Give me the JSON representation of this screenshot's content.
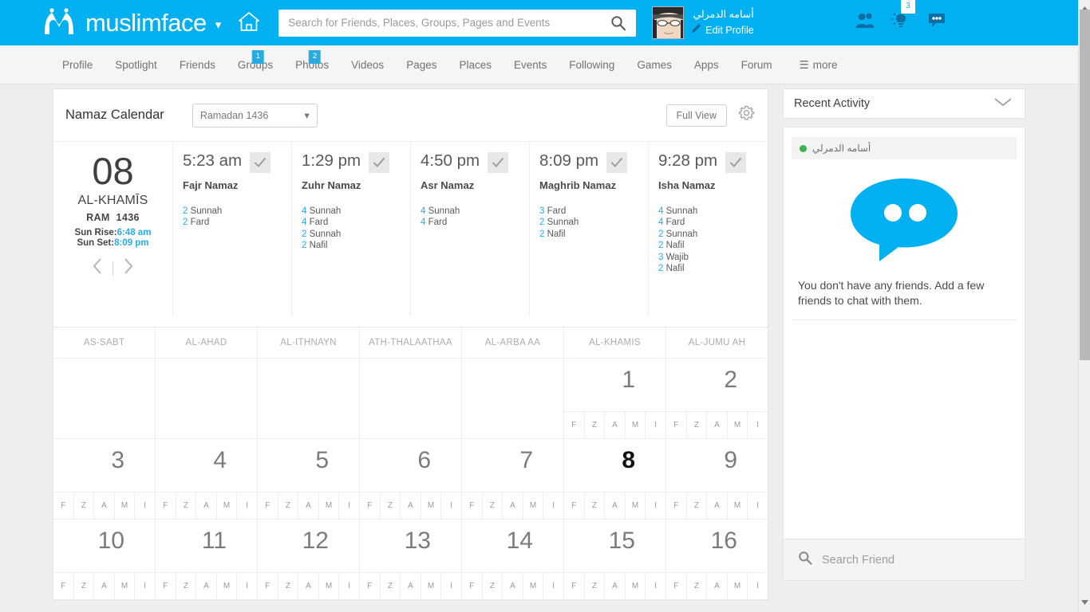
{
  "topbar": {
    "brand": "muslimface",
    "brand_caret": "chevron-down",
    "search_placeholder": "Search for Friends, Places, Groups, Pages and Events",
    "search_value": "",
    "user_name": "أسامه الدمرلي",
    "edit_profile": "Edit Profile",
    "notification_badge": "3",
    "accent": "#00b0f0"
  },
  "nav": {
    "items": [
      {
        "label": "Profile",
        "badge": ""
      },
      {
        "label": "Spotlight",
        "badge": ""
      },
      {
        "label": "Friends",
        "badge": ""
      },
      {
        "label": "Groups",
        "badge": "1"
      },
      {
        "label": "Photos",
        "badge": "2"
      },
      {
        "label": "Videos",
        "badge": ""
      },
      {
        "label": "Pages",
        "badge": ""
      },
      {
        "label": "Places",
        "badge": ""
      },
      {
        "label": "Events",
        "badge": ""
      },
      {
        "label": "Following",
        "badge": ""
      },
      {
        "label": "Games",
        "badge": ""
      },
      {
        "label": "Apps",
        "badge": ""
      },
      {
        "label": "Forum",
        "badge": ""
      }
    ],
    "more_label": "more",
    "badge_color": "#29abe2"
  },
  "calendar": {
    "title": "Namaz Calendar",
    "month_select": "Ramadan 1436",
    "full_view_label": "Full View",
    "settings_icon": "gear-icon",
    "day": {
      "number": "08",
      "name": "AL-KHAMĪS",
      "month_abbr": "RAM",
      "year": "1436",
      "sun_rise_label": "Sun Rise:",
      "sun_rise_value": "6:48 am",
      "sun_set_label": "Sun Set:",
      "sun_set_value": "8:09 pm"
    },
    "prayers": [
      {
        "time": "5:23 am",
        "name": "Fajr Namaz",
        "checked": true,
        "units": [
          {
            "count": "2",
            "type": "Sunnah"
          },
          {
            "count": "2",
            "type": "Fard"
          }
        ]
      },
      {
        "time": "1:29 pm",
        "name": "Zuhr Namaz",
        "checked": true,
        "units": [
          {
            "count": "4",
            "type": "Sunnah"
          },
          {
            "count": "4",
            "type": "Fard"
          },
          {
            "count": "2",
            "type": "Sunnah"
          },
          {
            "count": "2",
            "type": "Nafil"
          }
        ]
      },
      {
        "time": "4:50 pm",
        "name": "Asr Namaz",
        "checked": true,
        "units": [
          {
            "count": "4",
            "type": "Sunnah"
          },
          {
            "count": "4",
            "type": "Fard"
          }
        ]
      },
      {
        "time": "8:09 pm",
        "name": "Maghrib Namaz",
        "checked": true,
        "units": [
          {
            "count": "3",
            "type": "Fard"
          },
          {
            "count": "2",
            "type": "Sunnah"
          },
          {
            "count": "2",
            "type": "Nafil"
          }
        ]
      },
      {
        "time": "9:28 pm",
        "name": "Isha Namaz",
        "checked": true,
        "units": [
          {
            "count": "4",
            "type": "Sunnah"
          },
          {
            "count": "4",
            "type": "Fard"
          },
          {
            "count": "2",
            "type": "Sunnah"
          },
          {
            "count": "2",
            "type": "Nafil"
          },
          {
            "count": "3",
            "type": "Wajib"
          },
          {
            "count": "2",
            "type": "Nafil"
          }
        ]
      }
    ],
    "weekday_headers": [
      "AS-SABT",
      "AL-AHAD",
      "AL-ITHNAYN",
      "ATH-THALAATHAA",
      "AL-ARBA AA",
      "AL-KHAMIS",
      "AL-JUMU AH"
    ],
    "prayer_marks": [
      "F",
      "Z",
      "A",
      "M",
      "I"
    ],
    "weeks": [
      [
        {
          "day": "",
          "empty": true
        },
        {
          "day": "",
          "empty": true
        },
        {
          "day": "",
          "empty": true
        },
        {
          "day": "",
          "empty": true
        },
        {
          "day": "",
          "empty": true
        },
        {
          "day": "1",
          "empty": false
        },
        {
          "day": "2",
          "empty": false
        }
      ],
      [
        {
          "day": "3",
          "empty": false
        },
        {
          "day": "4",
          "empty": false
        },
        {
          "day": "5",
          "empty": false
        },
        {
          "day": "6",
          "empty": false
        },
        {
          "day": "7",
          "empty": false
        },
        {
          "day": "8",
          "empty": false,
          "today": true
        },
        {
          "day": "9",
          "empty": false
        }
      ],
      [
        {
          "day": "10",
          "empty": false
        },
        {
          "day": "11",
          "empty": false
        },
        {
          "day": "12",
          "empty": false
        },
        {
          "day": "13",
          "empty": false
        },
        {
          "day": "14",
          "empty": false
        },
        {
          "day": "15",
          "empty": false
        },
        {
          "day": "16",
          "empty": false
        }
      ]
    ]
  },
  "rail": {
    "header_title": "Recent Activity",
    "collapse_icon": "chevron-down-icon",
    "me_name": "أسامه الدمرلي",
    "status": "online",
    "empty_message": "You don't have any friends. Add a few friends to chat with them.",
    "search_placeholder": "Search Friend",
    "search_value": "",
    "bubble_color": "#00b0f0",
    "online_color": "#39b54a"
  }
}
